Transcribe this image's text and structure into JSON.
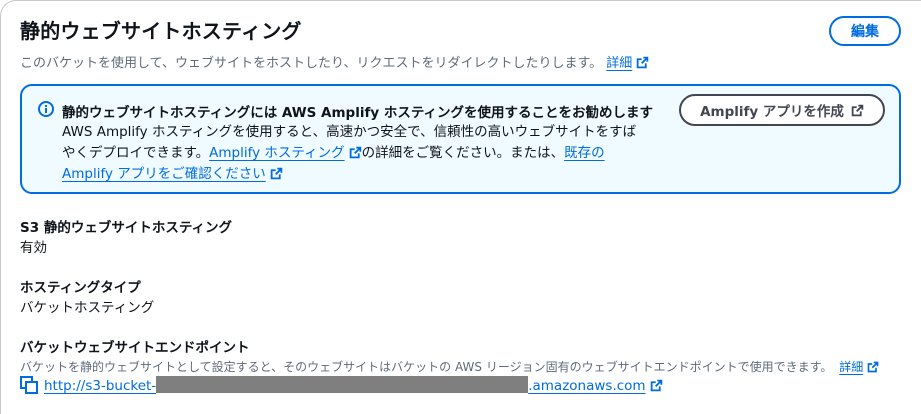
{
  "section": {
    "title": "静的ウェブサイトホスティング",
    "edit_label": "編集",
    "description": "このバケットを使用して、ウェブサイトをホストしたり、リクエストをリダイレクトしたりします。",
    "description_link": "詳細"
  },
  "alert": {
    "title": "静的ウェブサイトホスティングには AWS Amplify ホスティングを使用することをお勧めします",
    "body_line1": "AWS Amplify ホスティングを使用すると、高速かつ安全で、信頼性の高いウェブサイトをすば",
    "body_line2_prefix": "やくデプロイできます。",
    "body_link1": "Amplify ホスティング",
    "body_line2_middle": "の詳細をご覧ください。または、",
    "body_link2_part1": "既存の",
    "body_link2_part2": "Amplify アプリをご確認ください",
    "button_label": "Amplify アプリを作成"
  },
  "fields": {
    "hosting_label": "S3 静的ウェブサイトホスティング",
    "hosting_value": "有効",
    "type_label": "ホスティングタイプ",
    "type_value": "バケットホスティング",
    "endpoint_label": "バケットウェブサイトエンドポイント",
    "endpoint_desc": "バケットを静的ウェブサイトとして設定すると、そのウェブサイトはバケットの AWS リージョン固有のウェブサイトエンドポイントで使用できます。",
    "endpoint_desc_link": "詳細",
    "endpoint_url_prefix": "http://s3-bucket-",
    "endpoint_url_suffix": ".amazonaws.com"
  },
  "colors": {
    "link": "#006ce0",
    "alert_border": "#006ce0",
    "alert_bg": "#f0fbff",
    "text": "#0f141a",
    "muted": "#5f6b7a"
  },
  "icons": [
    "info-icon",
    "external-link-icon",
    "copy-icon"
  ]
}
